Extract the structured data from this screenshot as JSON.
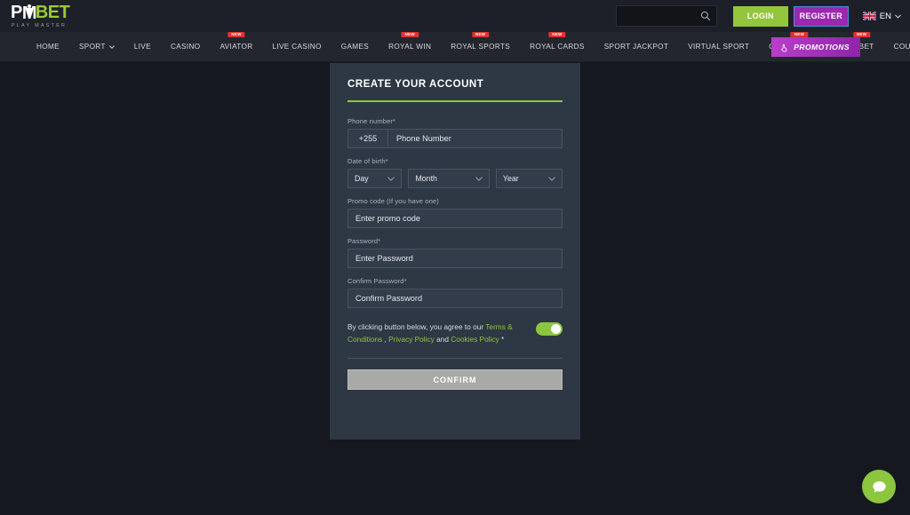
{
  "brand": {
    "logo_p": "P",
    "logo_m": "M",
    "logo_bet": "BET",
    "tagline": "PLAY MASTER",
    "accent_green": "#8cc63f",
    "accent_purple": "#9c27b0",
    "badge_red": "#e03131"
  },
  "header": {
    "search": {
      "value": "",
      "placeholder": ""
    },
    "login_label": "LOGIN",
    "register_label": "REGISTER",
    "language": {
      "code": "EN",
      "flag": "uk-flag-icon"
    }
  },
  "nav": {
    "items": [
      {
        "label": "HOME",
        "badge": "",
        "caret": false
      },
      {
        "label": "SPORT",
        "badge": "",
        "caret": true
      },
      {
        "label": "LIVE",
        "badge": "",
        "caret": false
      },
      {
        "label": "CASINO",
        "badge": "",
        "caret": false
      },
      {
        "label": "AVIATOR",
        "badge": "NEW",
        "caret": false
      },
      {
        "label": "LIVE CASINO",
        "badge": "",
        "caret": false
      },
      {
        "label": "GAMES",
        "badge": "",
        "caret": false
      },
      {
        "label": "ROYAL WIN",
        "badge": "NEW",
        "caret": false
      },
      {
        "label": "ROYAL SPORTS",
        "badge": "NEW",
        "caret": false
      },
      {
        "label": "ROYAL CARDS",
        "badge": "NEW",
        "caret": false
      },
      {
        "label": "SPORT JACKPOT",
        "badge": "",
        "caret": false
      },
      {
        "label": "VIRTUAL SPORT",
        "badge": "",
        "caret": false
      },
      {
        "label": "CRAZY ROCKET",
        "badge": "NEW",
        "caret": false
      },
      {
        "label": "TVBET",
        "badge": "NEW",
        "caret": false
      },
      {
        "label": "COUPON CHECK",
        "badge": "",
        "caret": false
      }
    ],
    "promotions_label": "PROMOTIONS"
  },
  "form": {
    "title": "CREATE YOUR ACCOUNT",
    "phone": {
      "label": "Phone number*",
      "country_code": "+255",
      "value": "",
      "placeholder": "Phone Number"
    },
    "dob": {
      "label": "Date of birth*",
      "day": "Day",
      "month": "Month",
      "year": "Year"
    },
    "promo": {
      "label": "Promo code (If you have one)",
      "value": "",
      "placeholder": "Enter promo code"
    },
    "password": {
      "label": "Password*",
      "value": "",
      "placeholder": "Enter Password"
    },
    "confirm_password": {
      "label": "Confirm Password*",
      "value": "",
      "placeholder": "Confirm Password"
    },
    "terms": {
      "intro": "By clicking button below, you agree to our",
      "link_terms": "Terms & Conditions",
      "separator": " , ",
      "link_privacy": "Privacy Policy",
      "conjunction": " and ",
      "link_cookies": "Cookies Policy",
      "required_mark": " *",
      "toggle_on": true
    },
    "confirm_button": "CONFIRM"
  },
  "chat": {
    "icon": "chat-bubble-icon"
  }
}
